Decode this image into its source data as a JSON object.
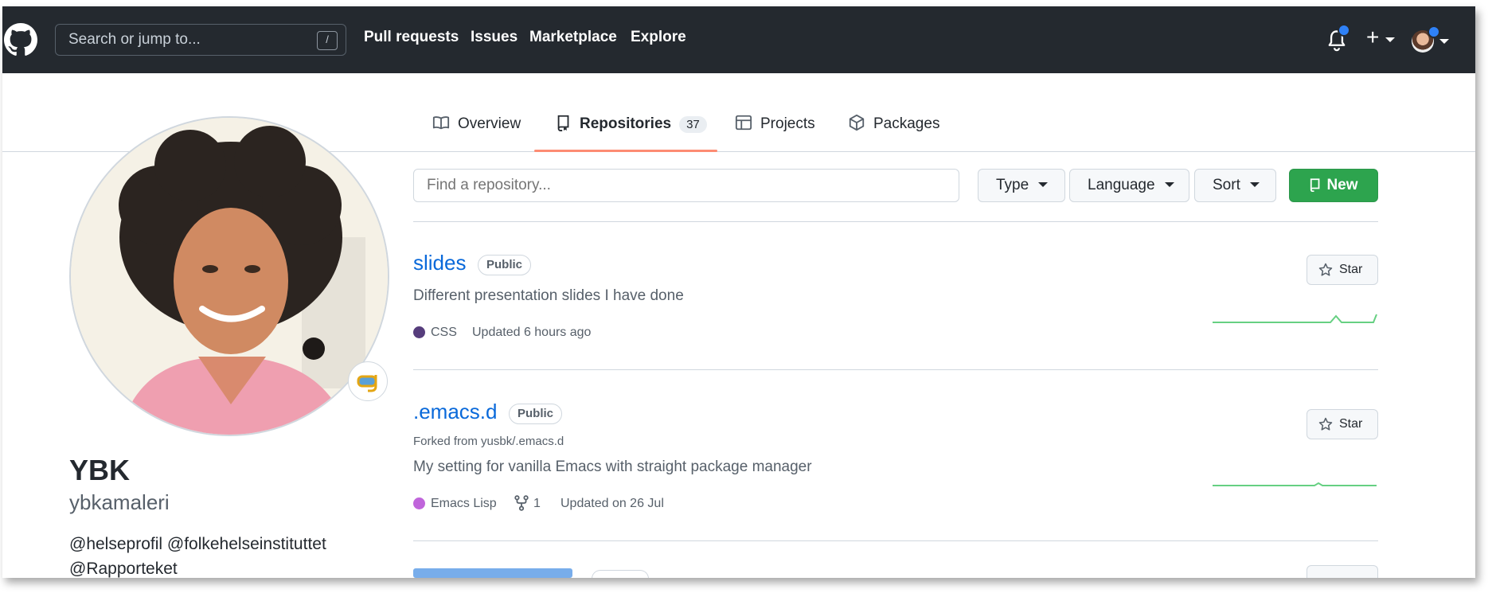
{
  "header": {
    "search_placeholder": "Search or jump to...",
    "search_shortcut": "/",
    "nav": [
      "Pull requests",
      "Issues",
      "Marketplace",
      "Explore"
    ],
    "plus_label": "+"
  },
  "tabs": [
    {
      "label": "Overview"
    },
    {
      "label": "Repositories",
      "count": "37"
    },
    {
      "label": "Projects"
    },
    {
      "label": "Packages"
    }
  ],
  "profile": {
    "name": "YBK",
    "username": "ybkamaleri",
    "bio_line1": "@helseprofil @folkehelseinstituttet",
    "bio_line2": "@Rapporteket"
  },
  "filters": {
    "find_placeholder": "Find a repository...",
    "type_label": "Type",
    "language_label": "Language",
    "sort_label": "Sort",
    "new_label": "New"
  },
  "repos": [
    {
      "name": "slides",
      "visibility": "Public",
      "description": "Different presentation slides I have done",
      "language": "CSS",
      "language_color": "#563d7c",
      "updated": "Updated 6 hours ago",
      "star_label": "Star"
    },
    {
      "name": ".emacs.d",
      "visibility": "Public",
      "forked_from": "Forked from yusbk/.emacs.d",
      "description": "My setting for vanilla Emacs with straight package manager",
      "language": "Emacs Lisp",
      "language_color": "#c065db",
      "forks": "1",
      "updated": "Updated on 26 Jul",
      "star_label": "Star"
    }
  ],
  "colors": {
    "header_bg": "#24292f",
    "link": "#0969da",
    "new_button": "#2da44e",
    "active_tab_underline": "#fd8c73",
    "notification_dot": "#2f81f7"
  }
}
